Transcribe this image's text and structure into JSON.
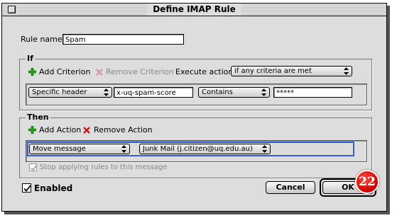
{
  "window": {
    "title": "Define IMAP Rule"
  },
  "rule_name": {
    "label": "Rule name:",
    "value": "Spam"
  },
  "if_group": {
    "title": "If",
    "add_criterion": "Add Criterion",
    "remove_criterion": "Remove Criterion",
    "execute_actions_label": "Execute actions",
    "execute_actions_value": "if any criteria are met",
    "criterion": {
      "field": "Specific header",
      "header_value": "x-uq-spam-score",
      "operator": "Contains",
      "match_value": "*****"
    }
  },
  "then_group": {
    "title": "Then",
    "add_action": "Add Action",
    "remove_action": "Remove Action",
    "action": {
      "type": "Move message",
      "target": "Junk Mail (j.citizen@uq.edu.au)"
    },
    "stop_applying_label": "Stop applying rules to this message",
    "stop_applying_checked": true
  },
  "enabled": {
    "label": "Enabled",
    "checked": true
  },
  "buttons": {
    "cancel": "Cancel",
    "ok": "OK"
  },
  "badge": {
    "number": "22"
  },
  "colors": {
    "selection": "#3060c8",
    "add_icon": "#2a9a20",
    "remove_icon": "#cc1a1a",
    "badge": "#dd0000"
  }
}
